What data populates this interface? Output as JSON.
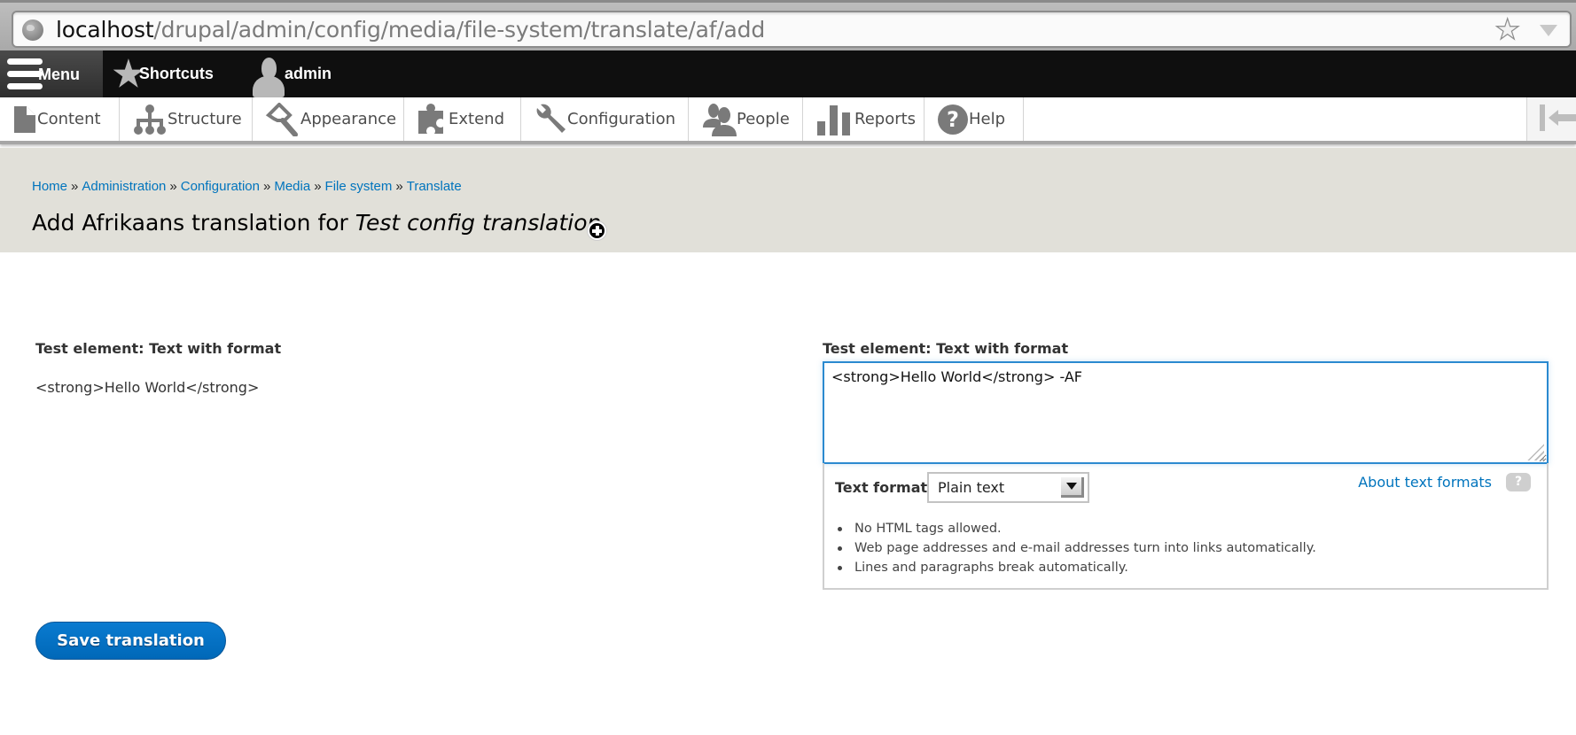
{
  "browser": {
    "url_host": "localhost",
    "url_path": "/drupal/admin/config/media/file-system/translate/af/add"
  },
  "toolbar": {
    "menu_label": "Menu",
    "shortcuts_label": "Shortcuts",
    "user_label": "admin"
  },
  "tray": {
    "items": [
      {
        "label": "Content",
        "icon": "document-icon"
      },
      {
        "label": "Structure",
        "icon": "sitemap-icon"
      },
      {
        "label": "Appearance",
        "icon": "paintbrush-icon"
      },
      {
        "label": "Extend",
        "icon": "puzzle-icon"
      },
      {
        "label": "Configuration",
        "icon": "wrench-icon"
      },
      {
        "label": "People",
        "icon": "people-icon"
      },
      {
        "label": "Reports",
        "icon": "bar-chart-icon"
      },
      {
        "label": "Help",
        "icon": "question-icon"
      }
    ]
  },
  "breadcrumb": {
    "items": [
      "Home",
      "Administration",
      "Configuration",
      "Media",
      "File system",
      "Translate"
    ],
    "separator": "»"
  },
  "page": {
    "title_prefix": "Add Afrikaans translation for ",
    "title_emphasis": "Test config translation"
  },
  "source": {
    "label": "Test element: Text with format",
    "value": "<strong>Hello World</strong>"
  },
  "translation": {
    "label": "Test element: Text with format",
    "value": "<strong>Hello World</strong> -AF"
  },
  "text_format": {
    "label": "Text format",
    "selected": "Plain text",
    "about_link": "About text formats",
    "help_glyph": "?",
    "tips": [
      "No HTML tags allowed.",
      "Web page addresses and e-mail addresses turn into links automatically.",
      "Lines and paragraphs break automatically."
    ]
  },
  "actions": {
    "save_label": "Save translation"
  },
  "colors": {
    "link": "#0074bd",
    "primary_button": "#0074bd",
    "header_bg": "#e1e0d9",
    "toolbar_bg": "#0f0f0f",
    "focus_border": "#2b8ad0"
  }
}
